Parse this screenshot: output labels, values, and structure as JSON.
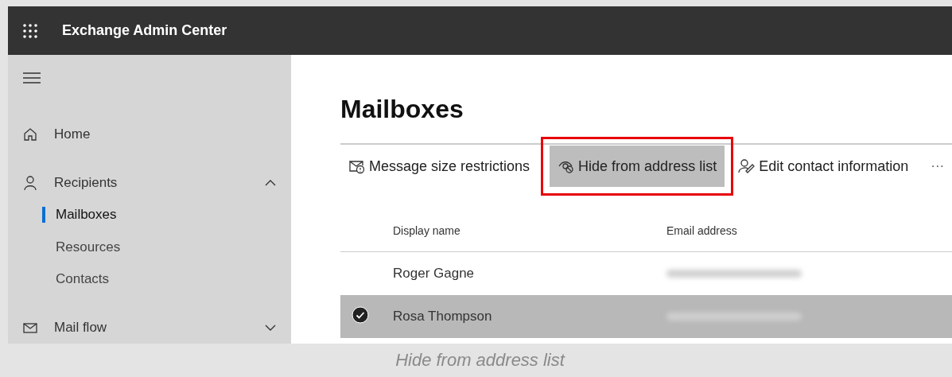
{
  "app_bar": {
    "title": "Exchange Admin Center"
  },
  "sidebar": {
    "items": [
      {
        "label": "Home",
        "kind": "home"
      },
      {
        "label": "Recipients",
        "kind": "person",
        "expanded": true,
        "children": [
          {
            "label": "Mailboxes",
            "selected": true
          },
          {
            "label": "Resources",
            "selected": false
          },
          {
            "label": "Contacts",
            "selected": false
          }
        ]
      },
      {
        "label": "Mail flow",
        "kind": "mail",
        "expanded": false
      }
    ]
  },
  "page": {
    "title": "Mailboxes"
  },
  "toolbar": {
    "items": [
      {
        "label": "Message size restrictions",
        "kind": "mail-alert",
        "selected": false,
        "highlighted": false
      },
      {
        "label": "Hide from address list",
        "kind": "eye-hide",
        "selected": true,
        "highlighted": true
      },
      {
        "label": "Edit contact information",
        "kind": "person-edit",
        "selected": false,
        "highlighted": false
      }
    ],
    "more": "···"
  },
  "table": {
    "columns": [
      "Display name",
      "Email address"
    ],
    "rows": [
      {
        "display_name": "Roger Gagne",
        "selected": false
      },
      {
        "display_name": "Rosa Thompson",
        "selected": true
      }
    ]
  },
  "caption": "Hide from address list"
}
